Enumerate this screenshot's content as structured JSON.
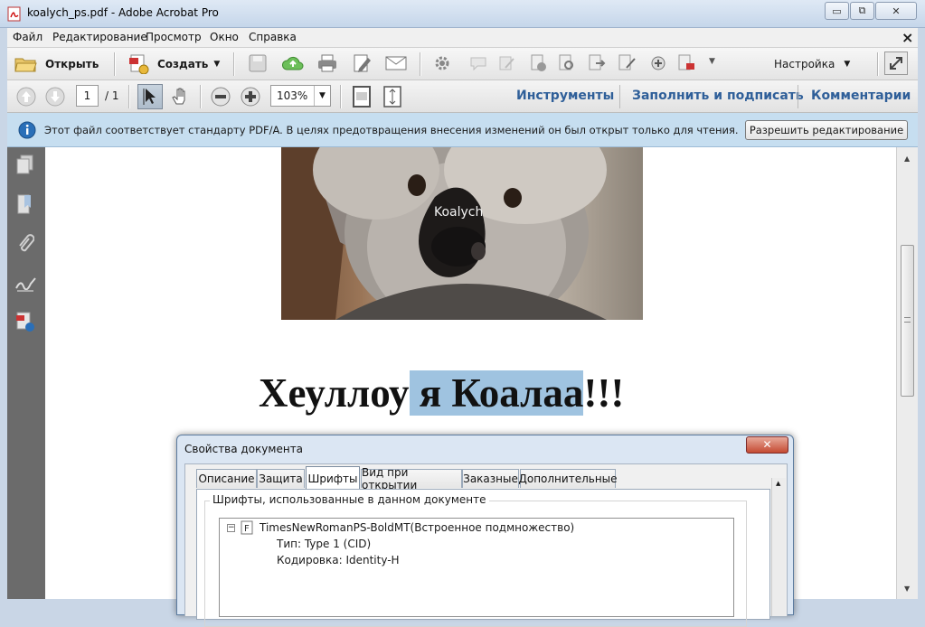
{
  "window": {
    "title": "koalych_ps.pdf - Adobe Acrobat Pro",
    "minimize": "▭",
    "restore": "⧉",
    "close": "✕"
  },
  "menu": {
    "items": [
      "Файл",
      "Редактирование",
      "Просмотр",
      "Окно",
      "Справка"
    ],
    "close": "×"
  },
  "toolbar": {
    "open_label": "Открыть",
    "create_label": "Создать",
    "settings_label": "Настройка"
  },
  "nav": {
    "page_current": "1",
    "page_total": "/ 1",
    "zoom": "103%",
    "tools_label": "Инструменты",
    "fill_sign_label": "Заполнить и подписать",
    "comments_label": "Комментарии"
  },
  "infobar": {
    "message": "Этот файл соответствует стандарту PDF/A. В целях предотвращения внесения изменений он был открыт только для чтения.",
    "enable_editing": "Разрешить редактирование"
  },
  "document": {
    "image_caption": "Koalych",
    "heading_before": "Хеуллоу",
    "heading_selected": " я Коалаа",
    "heading_after": "!!!"
  },
  "dialog": {
    "title": "Свойства документа",
    "tabs": [
      "Описание",
      "Защита",
      "Шрифты",
      "Вид при открытии",
      "Заказные",
      "Дополнительные"
    ],
    "active_tab": 2,
    "group_label": "Шрифты, использованные в данном документе",
    "font_name": "TimesNewRomanPS-BoldMT(Встроенное подмножество)",
    "font_type": "Тип: Type 1 (CID)",
    "font_encoding": "Кодировка: Identity-H",
    "close": "✕"
  },
  "colors": {
    "selection": "#9fc3e0",
    "accent_blue": "#2f5f99",
    "nav_panel": "#6b6b6b"
  }
}
